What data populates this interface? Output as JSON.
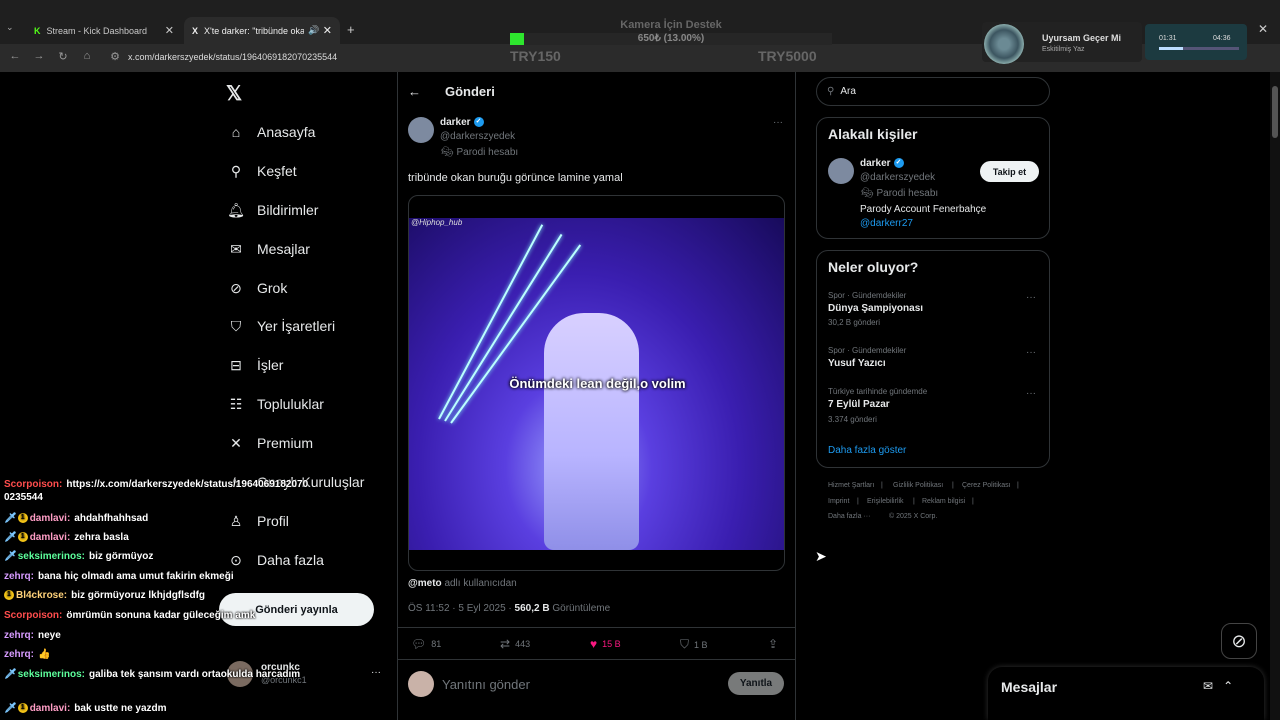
{
  "browser": {
    "tabs": [
      {
        "label": "Stream - Kick Dashboard",
        "favicon": "K"
      },
      {
        "label": "X'te darker: \"tribünde okan",
        "favicon": "X"
      }
    ],
    "url": "x.com/darkerszyedek/status/1964069182070235544"
  },
  "overlay": {
    "title": "Kamera İçin Destek",
    "amount": "650₺ (13.00%)",
    "progress": 0.13,
    "min": "TRY150",
    "max": "TRY5000",
    "song": "Uyursam Geçer Mi",
    "artist": "Eskitilmiş Yaz",
    "time_current": "01:31",
    "time_total": "04:36"
  },
  "nav": {
    "items": [
      "Anasayfa",
      "Keşfet",
      "Bildirimler",
      "Mesajlar",
      "Grok",
      "Yer İşaretleri",
      "İşler",
      "Topluluklar",
      "Premium",
      "Onaylı Kuruluşlar",
      "Profil",
      "Daha fazla"
    ],
    "post_button": "Gönderi yayınla",
    "account_name": "orcunkc",
    "account_handle": "@orcunkc1"
  },
  "post": {
    "header": "Gönderi",
    "name": "darker",
    "handle": "@darkerszyedek",
    "parody": "Parodi hesabı",
    "text": "tribünde okan buruğu görünce lamine yamal",
    "watermark": "@Hiphop_hub",
    "subtitle": "Önümdeki lean değil,o volim",
    "credit_user": "@meto",
    "credit_suffix": "adlı kullanıcıdan",
    "time": "ÖS 11:52 · 5 Eyl 2025 · ",
    "views": "560,2 B",
    "views_label": "Görüntüleme",
    "replies": "81",
    "reposts": "443",
    "likes": "15 B",
    "bookmarks": "1 B",
    "reply_placeholder": "Yanıtını gönder",
    "reply_button": "Yanıtla"
  },
  "sidebar": {
    "search": "Ara",
    "relevant_title": "Alakalı kişiler",
    "person_name": "darker",
    "person_handle": "@darkerszyedek",
    "person_parody": "Parodi hesabı",
    "person_bio": "Parody Account Fenerbahçe",
    "person_link": "@darkerr27",
    "follow_button": "Takip et",
    "trends_title": "Neler oluyor?",
    "trends": [
      {
        "category": "Spor · Gündemdekiler",
        "name": "Dünya Şampiyonası",
        "count": "30,2 B gönderi"
      },
      {
        "category": "Spor · Gündemdekiler",
        "name": "Yusuf Yazıcı",
        "count": ""
      },
      {
        "category": "Türkiye tarihinde gündemde",
        "name": "7 Eylül Pazar",
        "count": "3.374 gönderi"
      }
    ],
    "show_more": "Daha fazla göster",
    "footer": [
      "Hizmet Şartları",
      "|",
      "Gizlilik Politikası",
      "|",
      "Çerez Politikası",
      "|",
      "Imprint",
      "|",
      "Erişilebilirlik",
      "|",
      "Reklam bilgisi",
      "|",
      "Daha fazla ···",
      "© 2025 X Corp."
    ],
    "messages": "Mesajlar"
  },
  "chat": [
    {
      "user": "Scorpoison:",
      "msg": "https://x.com/darkerszyedek/status/1964069182070",
      "color": "#ff4d4d",
      "badges": ""
    },
    {
      "user": "",
      "msg": "0235544",
      "color": "#fff",
      "badges": ""
    },
    {
      "user": "damlavi:",
      "msg": "ahdahfhahhsad",
      "color": "#ff9ec6",
      "badges": "full"
    },
    {
      "user": "damlavi:",
      "msg": "zehra basla",
      "color": "#ff9ec6",
      "badges": "full"
    },
    {
      "user": "seksimerinos:",
      "msg": "biz görmüyoz",
      "color": "#5dff9c",
      "badges": "sword"
    },
    {
      "user": "zehrq:",
      "msg": "bana hiç olmadı ama umut fakirin ekmeği",
      "color": "#d79bff",
      "badges": ""
    },
    {
      "user": "Bl4ckrose:",
      "msg": "biz görmüyoruz lkhjdgflsdfg",
      "color": "#ffd27a",
      "badges": "one"
    },
    {
      "user": "Scorpoison:",
      "msg": "ömrümün sonuna kadar güleceğim amk",
      "color": "#ff4d4d",
      "badges": ""
    },
    {
      "user": "zehrq:",
      "msg": "neye",
      "color": "#d79bff",
      "badges": ""
    },
    {
      "user": "zehrq:",
      "msg": "👍",
      "color": "#d79bff",
      "badges": ""
    },
    {
      "user": "seksimerinos:",
      "msg": "galiba tek şansım vardı ortaokulda harcadım",
      "color": "#5dff9c",
      "badges": "sword"
    },
    {
      "user": "damlavi:",
      "msg": "bak ustte ne yazdm",
      "color": "#ff9ec6",
      "badges": "full"
    }
  ],
  "colors": {
    "accent": "#1d9bf0",
    "like": "#f91880",
    "progress": "#2ee62e"
  }
}
